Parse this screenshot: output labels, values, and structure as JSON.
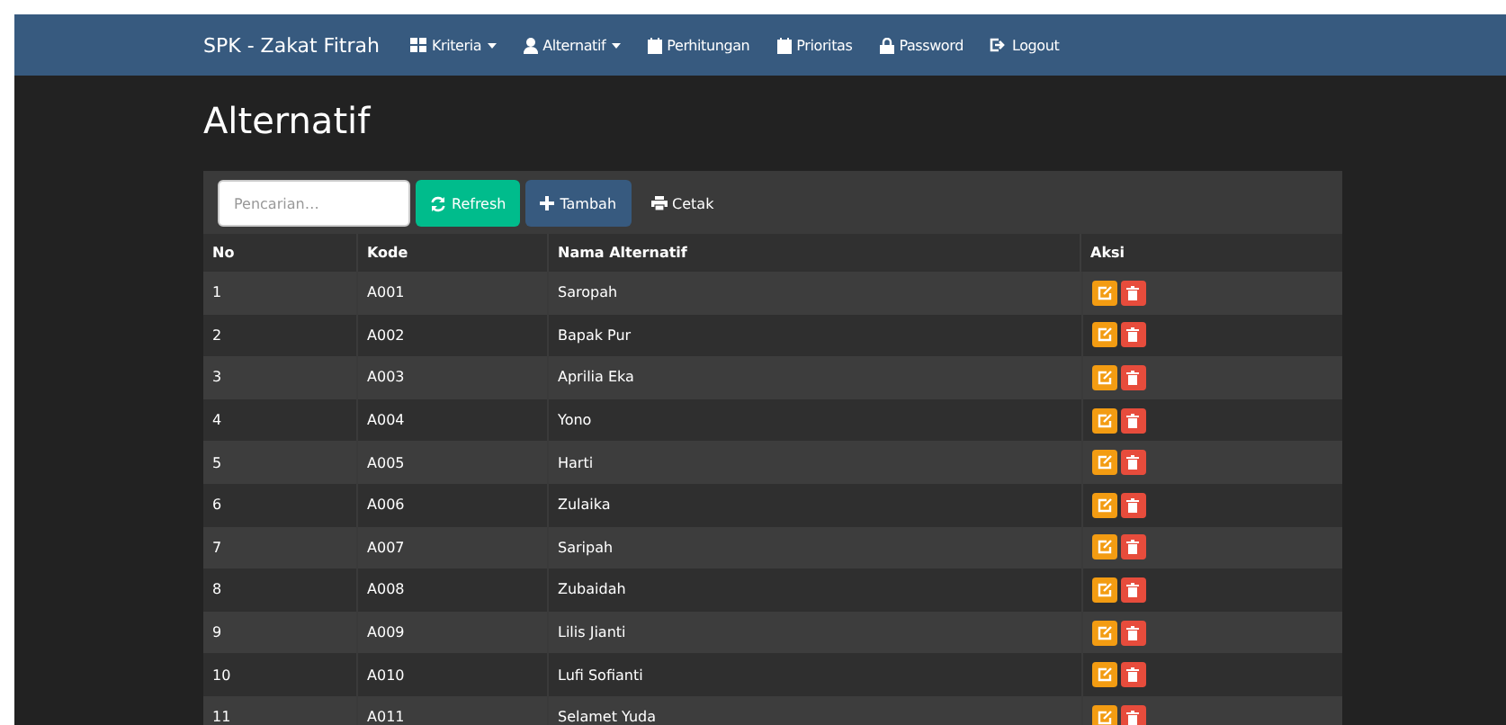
{
  "navbar": {
    "brand": "SPK - Zakat Fitrah",
    "items": [
      {
        "label": "Kriteria",
        "kind": "grid",
        "dropdown": true
      },
      {
        "label": "Alternatif",
        "kind": "user",
        "dropdown": true
      },
      {
        "label": "Perhitungan",
        "kind": "calendar",
        "dropdown": false
      },
      {
        "label": "Prioritas",
        "kind": "calendar",
        "dropdown": false
      },
      {
        "label": "Password",
        "kind": "lock",
        "dropdown": false
      },
      {
        "label": "Logout",
        "kind": "logout",
        "dropdown": false
      }
    ]
  },
  "page_title": "Alternatif",
  "toolbar": {
    "search": {
      "placeholder": "Pencarian…"
    },
    "buttons": [
      {
        "label": "Refresh",
        "kind": "refresh"
      },
      {
        "label": "Tambah",
        "kind": "add"
      },
      {
        "label": "Cetak",
        "kind": "print"
      }
    ]
  },
  "table": {
    "columns": [
      "No",
      "Kode",
      "Nama Alternatif",
      "Aksi"
    ],
    "rows": [
      {
        "no": "1",
        "kode": "A001",
        "nama": "Saropah"
      },
      {
        "no": "2",
        "kode": "A002",
        "nama": "Bapak Pur"
      },
      {
        "no": "3",
        "kode": "A003",
        "nama": "Aprilia Eka"
      },
      {
        "no": "4",
        "kode": "A004",
        "nama": "Yono"
      },
      {
        "no": "5",
        "kode": "A005",
        "nama": "Harti"
      },
      {
        "no": "6",
        "kode": "A006",
        "nama": "Zulaika"
      },
      {
        "no": "7",
        "kode": "A007",
        "nama": "Saripah"
      },
      {
        "no": "8",
        "kode": "A008",
        "nama": "Zubaidah"
      },
      {
        "no": "9",
        "kode": "A009",
        "nama": "Lilis Jianti"
      },
      {
        "no": "10",
        "kode": "A010",
        "nama": "Lufi Sofianti"
      },
      {
        "no": "11",
        "kode": "A011",
        "nama": "Selamet Yuda"
      }
    ]
  }
}
